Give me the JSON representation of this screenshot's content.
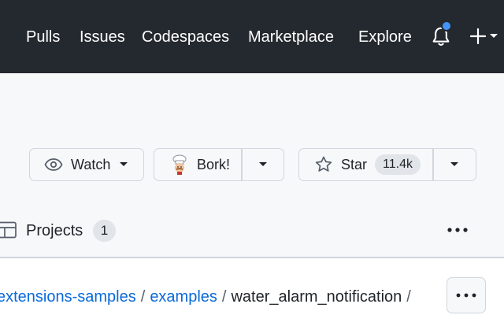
{
  "header": {
    "nav": [
      "Pulls",
      "Issues",
      "Codespaces",
      "Marketplace",
      "Explore"
    ],
    "notification_icon": "bell-icon",
    "notification_dot_color": "#4493f8",
    "create_icon": "plus-icon"
  },
  "actions": {
    "watch": {
      "label": "Watch",
      "icon": "eye-icon"
    },
    "fork": {
      "label": "Bork!",
      "icon": "chef-icon"
    },
    "star": {
      "label": "Star",
      "count": "11.4k",
      "icon": "star-icon"
    }
  },
  "tabs": {
    "projects": {
      "label": "Projects",
      "count": "1",
      "icon": "table-icon"
    }
  },
  "breadcrumb": {
    "parts": [
      "extensions-samples",
      "examples",
      "water_alarm_notification"
    ],
    "separator": "/"
  }
}
